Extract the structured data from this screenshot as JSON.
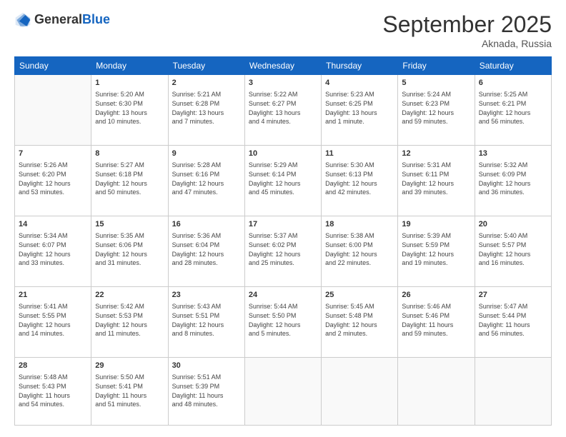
{
  "header": {
    "logo_line1": "General",
    "logo_line2": "Blue",
    "month": "September 2025",
    "location": "Aknada, Russia"
  },
  "days_of_week": [
    "Sunday",
    "Monday",
    "Tuesday",
    "Wednesday",
    "Thursday",
    "Friday",
    "Saturday"
  ],
  "weeks": [
    [
      {
        "day": "",
        "info": ""
      },
      {
        "day": "1",
        "info": "Sunrise: 5:20 AM\nSunset: 6:30 PM\nDaylight: 13 hours\nand 10 minutes."
      },
      {
        "day": "2",
        "info": "Sunrise: 5:21 AM\nSunset: 6:28 PM\nDaylight: 13 hours\nand 7 minutes."
      },
      {
        "day": "3",
        "info": "Sunrise: 5:22 AM\nSunset: 6:27 PM\nDaylight: 13 hours\nand 4 minutes."
      },
      {
        "day": "4",
        "info": "Sunrise: 5:23 AM\nSunset: 6:25 PM\nDaylight: 13 hours\nand 1 minute."
      },
      {
        "day": "5",
        "info": "Sunrise: 5:24 AM\nSunset: 6:23 PM\nDaylight: 12 hours\nand 59 minutes."
      },
      {
        "day": "6",
        "info": "Sunrise: 5:25 AM\nSunset: 6:21 PM\nDaylight: 12 hours\nand 56 minutes."
      }
    ],
    [
      {
        "day": "7",
        "info": "Sunrise: 5:26 AM\nSunset: 6:20 PM\nDaylight: 12 hours\nand 53 minutes."
      },
      {
        "day": "8",
        "info": "Sunrise: 5:27 AM\nSunset: 6:18 PM\nDaylight: 12 hours\nand 50 minutes."
      },
      {
        "day": "9",
        "info": "Sunrise: 5:28 AM\nSunset: 6:16 PM\nDaylight: 12 hours\nand 47 minutes."
      },
      {
        "day": "10",
        "info": "Sunrise: 5:29 AM\nSunset: 6:14 PM\nDaylight: 12 hours\nand 45 minutes."
      },
      {
        "day": "11",
        "info": "Sunrise: 5:30 AM\nSunset: 6:13 PM\nDaylight: 12 hours\nand 42 minutes."
      },
      {
        "day": "12",
        "info": "Sunrise: 5:31 AM\nSunset: 6:11 PM\nDaylight: 12 hours\nand 39 minutes."
      },
      {
        "day": "13",
        "info": "Sunrise: 5:32 AM\nSunset: 6:09 PM\nDaylight: 12 hours\nand 36 minutes."
      }
    ],
    [
      {
        "day": "14",
        "info": "Sunrise: 5:34 AM\nSunset: 6:07 PM\nDaylight: 12 hours\nand 33 minutes."
      },
      {
        "day": "15",
        "info": "Sunrise: 5:35 AM\nSunset: 6:06 PM\nDaylight: 12 hours\nand 31 minutes."
      },
      {
        "day": "16",
        "info": "Sunrise: 5:36 AM\nSunset: 6:04 PM\nDaylight: 12 hours\nand 28 minutes."
      },
      {
        "day": "17",
        "info": "Sunrise: 5:37 AM\nSunset: 6:02 PM\nDaylight: 12 hours\nand 25 minutes."
      },
      {
        "day": "18",
        "info": "Sunrise: 5:38 AM\nSunset: 6:00 PM\nDaylight: 12 hours\nand 22 minutes."
      },
      {
        "day": "19",
        "info": "Sunrise: 5:39 AM\nSunset: 5:59 PM\nDaylight: 12 hours\nand 19 minutes."
      },
      {
        "day": "20",
        "info": "Sunrise: 5:40 AM\nSunset: 5:57 PM\nDaylight: 12 hours\nand 16 minutes."
      }
    ],
    [
      {
        "day": "21",
        "info": "Sunrise: 5:41 AM\nSunset: 5:55 PM\nDaylight: 12 hours\nand 14 minutes."
      },
      {
        "day": "22",
        "info": "Sunrise: 5:42 AM\nSunset: 5:53 PM\nDaylight: 12 hours\nand 11 minutes."
      },
      {
        "day": "23",
        "info": "Sunrise: 5:43 AM\nSunset: 5:51 PM\nDaylight: 12 hours\nand 8 minutes."
      },
      {
        "day": "24",
        "info": "Sunrise: 5:44 AM\nSunset: 5:50 PM\nDaylight: 12 hours\nand 5 minutes."
      },
      {
        "day": "25",
        "info": "Sunrise: 5:45 AM\nSunset: 5:48 PM\nDaylight: 12 hours\nand 2 minutes."
      },
      {
        "day": "26",
        "info": "Sunrise: 5:46 AM\nSunset: 5:46 PM\nDaylight: 11 hours\nand 59 minutes."
      },
      {
        "day": "27",
        "info": "Sunrise: 5:47 AM\nSunset: 5:44 PM\nDaylight: 11 hours\nand 56 minutes."
      }
    ],
    [
      {
        "day": "28",
        "info": "Sunrise: 5:48 AM\nSunset: 5:43 PM\nDaylight: 11 hours\nand 54 minutes."
      },
      {
        "day": "29",
        "info": "Sunrise: 5:50 AM\nSunset: 5:41 PM\nDaylight: 11 hours\nand 51 minutes."
      },
      {
        "day": "30",
        "info": "Sunrise: 5:51 AM\nSunset: 5:39 PM\nDaylight: 11 hours\nand 48 minutes."
      },
      {
        "day": "",
        "info": ""
      },
      {
        "day": "",
        "info": ""
      },
      {
        "day": "",
        "info": ""
      },
      {
        "day": "",
        "info": ""
      }
    ]
  ]
}
